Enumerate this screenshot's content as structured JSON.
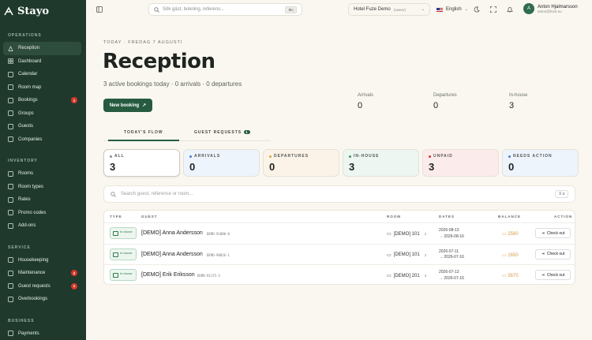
{
  "brand": {
    "name": "Stayo"
  },
  "sidebar": {
    "sections": [
      {
        "title": "OPERATIONS",
        "items": [
          {
            "label": "Reception",
            "icon": "bell-icon",
            "active": true
          },
          {
            "label": "Dashboard",
            "icon": "grid-icon"
          },
          {
            "label": "Calendar",
            "icon": "calendar-icon"
          },
          {
            "label": "Room map",
            "icon": "map-icon"
          },
          {
            "label": "Bookings",
            "icon": "book-icon",
            "badge": "1"
          },
          {
            "label": "Groups",
            "icon": "users-icon"
          },
          {
            "label": "Guests",
            "icon": "user-icon"
          },
          {
            "label": "Companies",
            "icon": "building-icon"
          }
        ]
      },
      {
        "title": "INVENTORY",
        "items": [
          {
            "label": "Rooms",
            "icon": "door-icon"
          },
          {
            "label": "Room types",
            "icon": "layers-icon"
          },
          {
            "label": "Rates",
            "icon": "tag-icon"
          },
          {
            "label": "Promo codes",
            "icon": "ticket-icon"
          },
          {
            "label": "Add-ons",
            "icon": "plus-box-icon"
          }
        ]
      },
      {
        "title": "SERVICE",
        "items": [
          {
            "label": "Housekeeping",
            "icon": "broom-icon"
          },
          {
            "label": "Maintenance",
            "icon": "wrench-icon",
            "badge": "2"
          },
          {
            "label": "Guest requests",
            "icon": "chat-icon",
            "badge": "1"
          },
          {
            "label": "Overbookings",
            "icon": "alert-icon"
          }
        ]
      },
      {
        "title": "BUSINESS",
        "items": [
          {
            "label": "Payments",
            "icon": "card-icon"
          },
          {
            "label": "Invoices",
            "icon": "doc-icon"
          }
        ]
      }
    ]
  },
  "topbar": {
    "search_placeholder": "Sök gäst, bokning, referens...",
    "search_kbd": "⌘K",
    "hotel": "Hotel Fuze Demo",
    "hotel_role": "(owner)",
    "language": "English",
    "user_initial": "A",
    "user_name": "Anton Hjalmarsson",
    "user_email": "anton@fuze.nu"
  },
  "page": {
    "date": "TODAY · FREDAG 7 AUGUSTI",
    "title": "Reception",
    "subtitle": "3 active bookings today · 0 arrivals · 0 departures",
    "new_booking": "New booking",
    "stats": [
      {
        "label": "Arrivals",
        "value": "0"
      },
      {
        "label": "Departures",
        "value": "0"
      },
      {
        "label": "In-house",
        "value": "3"
      }
    ],
    "tabs": [
      {
        "label": "TODAY'S FLOW"
      },
      {
        "label": "GUEST REQUESTS",
        "count": "1"
      }
    ],
    "cards": [
      {
        "label": "ALL",
        "value": "3",
        "color": "#8a8f8a",
        "bg": "#ffffff"
      },
      {
        "label": "ARRIVALS",
        "value": "0",
        "color": "#4a7fd1",
        "bg": "#eef4fb"
      },
      {
        "label": "DEPARTURES",
        "value": "0",
        "color": "#e0a24a",
        "bg": "#fbf3e8"
      },
      {
        "label": "IN-HOUSE",
        "value": "3",
        "color": "#3e9a64",
        "bg": "#edf6f0"
      },
      {
        "label": "UNPAID",
        "value": "3",
        "color": "#d9362b",
        "bg": "#fbeceb"
      },
      {
        "label": "NEEDS ACTION",
        "value": "0",
        "color": "#4a7fd1",
        "bg": "#eef4fb"
      }
    ],
    "list_search": "Search guest, reference or room...",
    "filter": "3",
    "headers": [
      "TYPE",
      "GUEST",
      "ROOM",
      "DATES",
      "BALANCE",
      "ACTION"
    ],
    "rows": [
      {
        "type": "In-house",
        "guest": "[DEMO] Anna Andersson",
        "ref": "DEMO-91880-0",
        "room": "[DEMO] 101",
        "guests": "2",
        "from": "2026-08-13",
        "to": "→ 2026-08-16",
        "balance": "2580",
        "action": "Check out"
      },
      {
        "type": "In-house",
        "guest": "[DEMO] Anna Andersson",
        "ref": "DEMO-90826-1",
        "room": "[DEMO] 101",
        "guests": "2",
        "from": "2026-07-11",
        "to": "→ 2026-07-16",
        "balance": "1650",
        "action": "Check out"
      },
      {
        "type": "In-house",
        "guest": "[DEMO] Erik Eriksson",
        "ref": "DEMO-91175-2",
        "room": "[DEMO] 201",
        "guests": "3",
        "from": "2026-07-13",
        "to": "→ 2026-07-16",
        "balance": "5670",
        "action": "Check out"
      }
    ]
  }
}
